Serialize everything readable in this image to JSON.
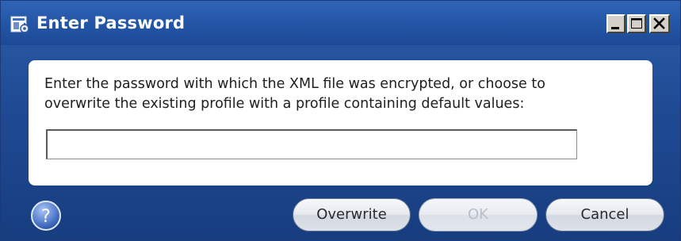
{
  "window": {
    "title": "Enter Password",
    "controls": {
      "minimize_icon": "minimize-icon",
      "maximize_icon": "maximize-icon",
      "close_icon": "close-icon"
    }
  },
  "dialog": {
    "message": "Enter the password with which the XML file was encrypted, or choose to\noverwrite the existing profile with a profile containing default values:",
    "password_value": "",
    "password_placeholder": ""
  },
  "buttons": {
    "overwrite": "Overwrite",
    "ok": "OK",
    "cancel": "Cancel",
    "help_icon": "help-icon"
  },
  "colors": {
    "title_bar": "#2456a7",
    "dialog_background": "#1f4a93",
    "content_background": "#ffffff",
    "disabled_text": "#b9bfc9"
  }
}
